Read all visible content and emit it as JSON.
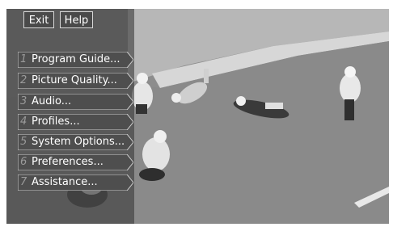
{
  "top_buttons": {
    "exit_label": "Exit",
    "help_label": "Help"
  },
  "menu": {
    "items": [
      {
        "number": "1",
        "label": "Program Guide..."
      },
      {
        "number": "2",
        "label": "Picture Quality..."
      },
      {
        "number": "3",
        "label": "Audio..."
      },
      {
        "number": "4",
        "label": "Profiles..."
      },
      {
        "number": "5",
        "label": "System Options..."
      },
      {
        "number": "6",
        "label": "Preferences..."
      },
      {
        "number": "7",
        "label": "Assistance..."
      }
    ]
  },
  "colors": {
    "button_fill": "#4a4a4a",
    "button_border": "#d8d8d8",
    "number_text": "#9a9a9a",
    "label_text": "#ffffff"
  }
}
